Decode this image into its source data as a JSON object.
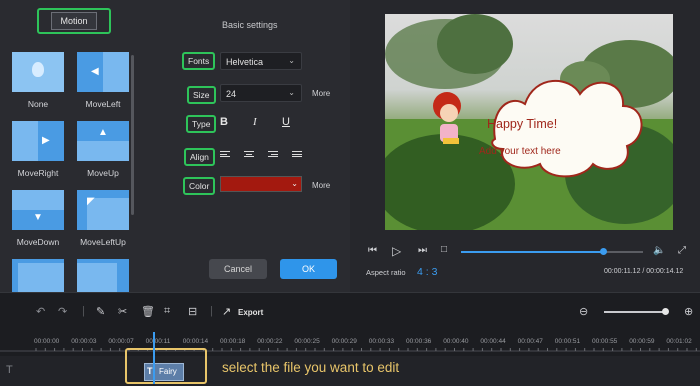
{
  "motion_panel": {
    "tab_label": "Motion",
    "effects": [
      "None",
      "MoveLeft",
      "MoveRight",
      "MoveUp",
      "MoveDown",
      "MoveLeftUp"
    ]
  },
  "settings": {
    "title": "Basic settings",
    "fonts_label": "Fonts",
    "font_value": "Helvetica",
    "size_label": "Size",
    "size_value": "24",
    "size_more": "More",
    "type_label": "Type",
    "type_bold": "B",
    "type_italic": "I",
    "type_underline": "U",
    "align_label": "Align",
    "color_label": "Color",
    "color_value": "#a3190f",
    "color_more": "More",
    "cancel_label": "Cancel",
    "ok_label": "OK"
  },
  "preview": {
    "bubble_title": "Happy Time!",
    "bubble_subtitle": "Add your text here",
    "aspect_label": "Aspect ratio",
    "aspect_value": "4 : 3",
    "time_display": "00:00:11.12 / 00:00:14.12",
    "progress": 0.78
  },
  "toolbar": {
    "export_label": "Export"
  },
  "timeline": {
    "ticks": [
      "00:00:00",
      "00:00:03",
      "00:00:07",
      "00:00:11",
      "00:00:14",
      "00:00:18",
      "00:00:22",
      "00:00:25",
      "00:00:29",
      "00:00:33",
      "00:00:36",
      "00:00:40",
      "00:00:44",
      "00:00:47",
      "00:00:51",
      "00:00:55",
      "00:00:59",
      "00:01:02"
    ],
    "clip_label": "Fairy",
    "hint_text": "select the file you want to edit"
  },
  "colors": {
    "accent": "#3b9cf0",
    "highlight": "#2ec45a",
    "callout": "#e8c56a"
  }
}
